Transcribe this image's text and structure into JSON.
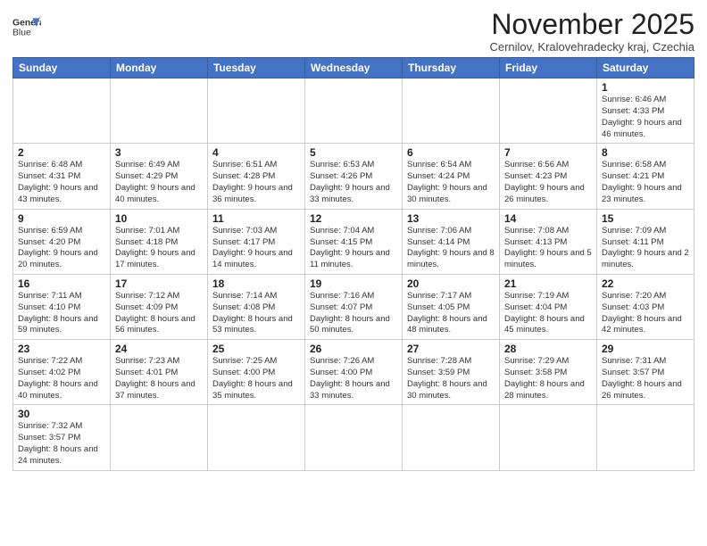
{
  "logo": {
    "line1": "General",
    "line2": "Blue"
  },
  "header": {
    "month_year": "November 2025",
    "location": "Cernilov, Kralovehradecky kraj, Czechia"
  },
  "weekdays": [
    "Sunday",
    "Monday",
    "Tuesday",
    "Wednesday",
    "Thursday",
    "Friday",
    "Saturday"
  ],
  "weeks": [
    [
      {
        "day": "",
        "info": ""
      },
      {
        "day": "",
        "info": ""
      },
      {
        "day": "",
        "info": ""
      },
      {
        "day": "",
        "info": ""
      },
      {
        "day": "",
        "info": ""
      },
      {
        "day": "",
        "info": ""
      },
      {
        "day": "1",
        "info": "Sunrise: 6:46 AM\nSunset: 4:33 PM\nDaylight: 9 hours and 46 minutes."
      }
    ],
    [
      {
        "day": "2",
        "info": "Sunrise: 6:48 AM\nSunset: 4:31 PM\nDaylight: 9 hours and 43 minutes."
      },
      {
        "day": "3",
        "info": "Sunrise: 6:49 AM\nSunset: 4:29 PM\nDaylight: 9 hours and 40 minutes."
      },
      {
        "day": "4",
        "info": "Sunrise: 6:51 AM\nSunset: 4:28 PM\nDaylight: 9 hours and 36 minutes."
      },
      {
        "day": "5",
        "info": "Sunrise: 6:53 AM\nSunset: 4:26 PM\nDaylight: 9 hours and 33 minutes."
      },
      {
        "day": "6",
        "info": "Sunrise: 6:54 AM\nSunset: 4:24 PM\nDaylight: 9 hours and 30 minutes."
      },
      {
        "day": "7",
        "info": "Sunrise: 6:56 AM\nSunset: 4:23 PM\nDaylight: 9 hours and 26 minutes."
      },
      {
        "day": "8",
        "info": "Sunrise: 6:58 AM\nSunset: 4:21 PM\nDaylight: 9 hours and 23 minutes."
      }
    ],
    [
      {
        "day": "9",
        "info": "Sunrise: 6:59 AM\nSunset: 4:20 PM\nDaylight: 9 hours and 20 minutes."
      },
      {
        "day": "10",
        "info": "Sunrise: 7:01 AM\nSunset: 4:18 PM\nDaylight: 9 hours and 17 minutes."
      },
      {
        "day": "11",
        "info": "Sunrise: 7:03 AM\nSunset: 4:17 PM\nDaylight: 9 hours and 14 minutes."
      },
      {
        "day": "12",
        "info": "Sunrise: 7:04 AM\nSunset: 4:15 PM\nDaylight: 9 hours and 11 minutes."
      },
      {
        "day": "13",
        "info": "Sunrise: 7:06 AM\nSunset: 4:14 PM\nDaylight: 9 hours and 8 minutes."
      },
      {
        "day": "14",
        "info": "Sunrise: 7:08 AM\nSunset: 4:13 PM\nDaylight: 9 hours and 5 minutes."
      },
      {
        "day": "15",
        "info": "Sunrise: 7:09 AM\nSunset: 4:11 PM\nDaylight: 9 hours and 2 minutes."
      }
    ],
    [
      {
        "day": "16",
        "info": "Sunrise: 7:11 AM\nSunset: 4:10 PM\nDaylight: 8 hours and 59 minutes."
      },
      {
        "day": "17",
        "info": "Sunrise: 7:12 AM\nSunset: 4:09 PM\nDaylight: 8 hours and 56 minutes."
      },
      {
        "day": "18",
        "info": "Sunrise: 7:14 AM\nSunset: 4:08 PM\nDaylight: 8 hours and 53 minutes."
      },
      {
        "day": "19",
        "info": "Sunrise: 7:16 AM\nSunset: 4:07 PM\nDaylight: 8 hours and 50 minutes."
      },
      {
        "day": "20",
        "info": "Sunrise: 7:17 AM\nSunset: 4:05 PM\nDaylight: 8 hours and 48 minutes."
      },
      {
        "day": "21",
        "info": "Sunrise: 7:19 AM\nSunset: 4:04 PM\nDaylight: 8 hours and 45 minutes."
      },
      {
        "day": "22",
        "info": "Sunrise: 7:20 AM\nSunset: 4:03 PM\nDaylight: 8 hours and 42 minutes."
      }
    ],
    [
      {
        "day": "23",
        "info": "Sunrise: 7:22 AM\nSunset: 4:02 PM\nDaylight: 8 hours and 40 minutes."
      },
      {
        "day": "24",
        "info": "Sunrise: 7:23 AM\nSunset: 4:01 PM\nDaylight: 8 hours and 37 minutes."
      },
      {
        "day": "25",
        "info": "Sunrise: 7:25 AM\nSunset: 4:00 PM\nDaylight: 8 hours and 35 minutes."
      },
      {
        "day": "26",
        "info": "Sunrise: 7:26 AM\nSunset: 4:00 PM\nDaylight: 8 hours and 33 minutes."
      },
      {
        "day": "27",
        "info": "Sunrise: 7:28 AM\nSunset: 3:59 PM\nDaylight: 8 hours and 30 minutes."
      },
      {
        "day": "28",
        "info": "Sunrise: 7:29 AM\nSunset: 3:58 PM\nDaylight: 8 hours and 28 minutes."
      },
      {
        "day": "29",
        "info": "Sunrise: 7:31 AM\nSunset: 3:57 PM\nDaylight: 8 hours and 26 minutes."
      }
    ],
    [
      {
        "day": "30",
        "info": "Sunrise: 7:32 AM\nSunset: 3:57 PM\nDaylight: 8 hours and 24 minutes."
      },
      {
        "day": "",
        "info": ""
      },
      {
        "day": "",
        "info": ""
      },
      {
        "day": "",
        "info": ""
      },
      {
        "day": "",
        "info": ""
      },
      {
        "day": "",
        "info": ""
      },
      {
        "day": "",
        "info": ""
      }
    ]
  ]
}
